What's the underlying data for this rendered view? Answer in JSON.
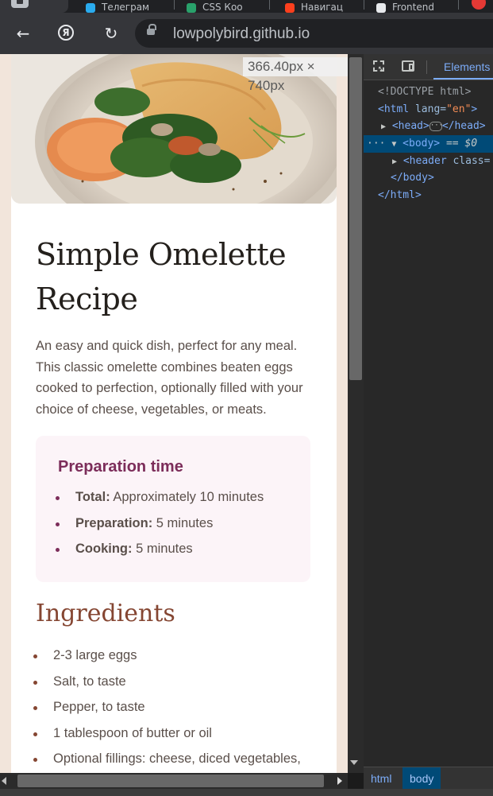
{
  "browser": {
    "tabs": [
      {
        "label": "Телеграм",
        "icon": "telegram-icon",
        "color": "#2aabee"
      },
      {
        "label": "CSS Коо",
        "icon": "css-icon",
        "color": "#29a16b"
      },
      {
        "label": "Навигац",
        "icon": "yandex-icon",
        "color": "#fc3f1d"
      },
      {
        "label": "Frontend",
        "icon": "page-icon",
        "color": "#e8eaed"
      }
    ],
    "url": "lowpolybird.github.io",
    "viewport_size_readout": "366.40px × 740px"
  },
  "recipe": {
    "title": "Simple Omelette Recipe",
    "intro": "An easy and quick dish, perfect for any meal. This classic omelette combines beaten eggs cooked to perfection, optionally filled with your choice of cheese, vegetables, or meats.",
    "preparation": {
      "title": "Preparation time",
      "items": [
        {
          "label": "Total:",
          "value": "Approximately 10 minutes"
        },
        {
          "label": "Preparation:",
          "value": "5 minutes"
        },
        {
          "label": "Cooking:",
          "value": "5 minutes"
        }
      ]
    },
    "ingredients": {
      "title": "Ingredients",
      "items": [
        "2-3 large eggs",
        "Salt, to taste",
        "Pepper, to taste",
        "1 tablespoon of butter or oil",
        "Optional fillings: cheese, diced vegetables,"
      ]
    }
  },
  "devtools": {
    "tabs": {
      "elements": "Elements"
    },
    "dom": {
      "doctype": "<!DOCTYPE html>",
      "html_open": "<html",
      "lang_attr": " lang=",
      "lang_val": "\"en\"",
      "gt": ">",
      "head_open": "<head>",
      "head_close": "</head>",
      "ellipsis": "···",
      "body_open": "<body>",
      "body_marker": " == $0",
      "header_open": "<header",
      "class_attr": " class=",
      "body_close": "</body>",
      "html_close": "</html>"
    },
    "breadcrumbs": [
      "html",
      "body"
    ]
  },
  "colors": {
    "page_bg": "#f2e5db",
    "prep_bg": "#fcf4f8",
    "prep_accent": "#7c2d5a",
    "ingredients_accent": "#854632",
    "devtools_selected": "#004a77"
  }
}
